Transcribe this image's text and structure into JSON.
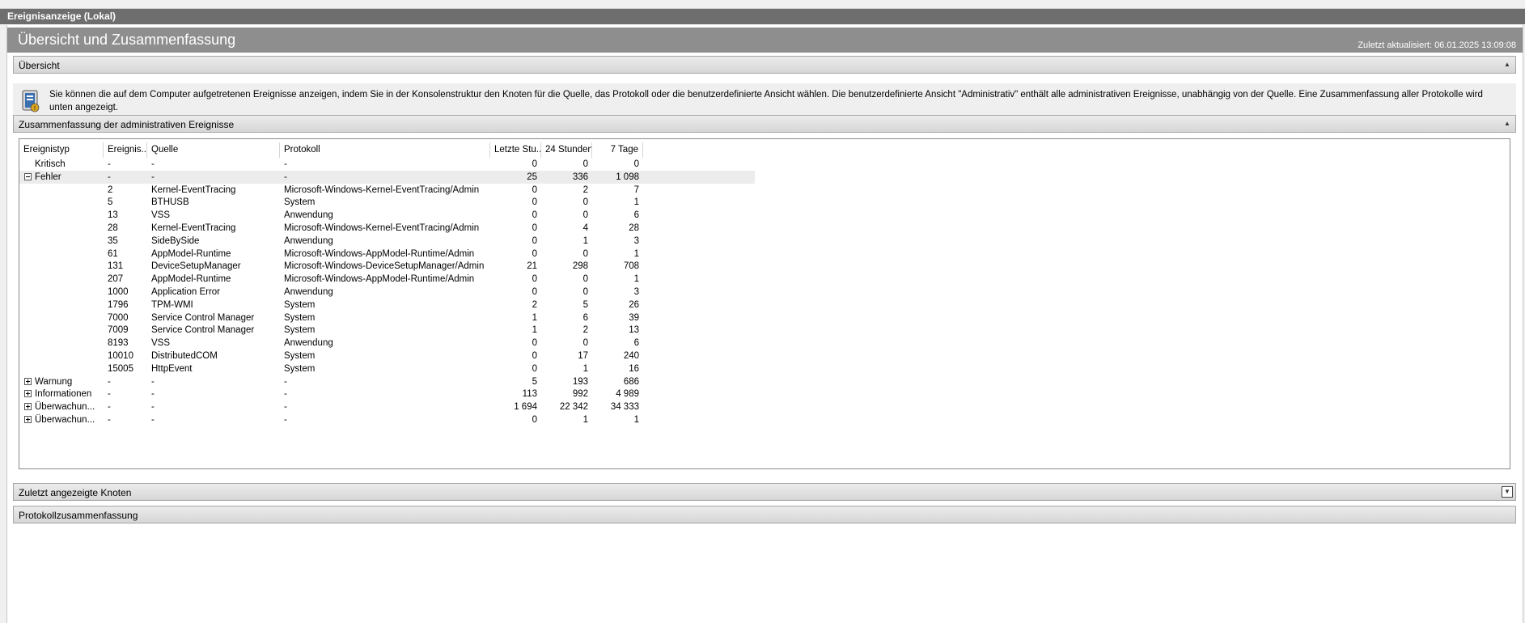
{
  "window": {
    "title": "Ereignisanzeige (Lokal)"
  },
  "header": {
    "title": "Übersicht und Zusammenfassung",
    "updated": "Zuletzt aktualisiert: 06.01.2025 13:09:08"
  },
  "sections": {
    "overview": {
      "label": "Übersicht",
      "toggle_icon": "collapse-icon"
    },
    "admin_summary": {
      "label": "Zusammenfassung der administrativen Ereignisse",
      "toggle_icon": "collapse-icon"
    },
    "recent_nodes": {
      "label": "Zuletzt angezeigte Knoten",
      "toggle_icon": "expand-icon"
    },
    "log_summary": {
      "label": "Protokollzusammenfassung"
    }
  },
  "overview_text": "Sie können die auf dem Computer aufgetretenen Ereignisse anzeigen, indem Sie in der Konsolenstruktur den Knoten für die Quelle, das Protokoll oder die benutzerdefinierte Ansicht wählen. Die benutzerdefinierte Ansicht \"Administrativ\" enthält alle administrativen Ereignisse, unabhängig von der Quelle. Eine Zusammenfassung aller Protokolle wird unten angezeigt.",
  "overview_icon": "event-viewer-icon",
  "table": {
    "columns": [
      "Ereignistyp",
      "Ereignis...",
      "Quelle",
      "Protokoll",
      "Letzte Stu...",
      "24 Stunden",
      "7 Tage"
    ],
    "rows": [
      {
        "type": "Kritisch",
        "id": "-",
        "source": "-",
        "log": "-",
        "hour": "0",
        "day": "0",
        "week": "0",
        "expander": "none"
      },
      {
        "type": "Fehler",
        "id": "-",
        "source": "-",
        "log": "-",
        "hour": "25",
        "day": "336",
        "week": "1 098",
        "expander": "minus",
        "selected": true
      },
      {
        "type": "",
        "id": "2",
        "source": "Kernel-EventTracing",
        "log": "Microsoft-Windows-Kernel-EventTracing/Admin",
        "hour": "0",
        "day": "2",
        "week": "7"
      },
      {
        "type": "",
        "id": "5",
        "source": "BTHUSB",
        "log": "System",
        "hour": "0",
        "day": "0",
        "week": "1"
      },
      {
        "type": "",
        "id": "13",
        "source": "VSS",
        "log": "Anwendung",
        "hour": "0",
        "day": "0",
        "week": "6"
      },
      {
        "type": "",
        "id": "28",
        "source": "Kernel-EventTracing",
        "log": "Microsoft-Windows-Kernel-EventTracing/Admin",
        "hour": "0",
        "day": "4",
        "week": "28"
      },
      {
        "type": "",
        "id": "35",
        "source": "SideBySide",
        "log": "Anwendung",
        "hour": "0",
        "day": "1",
        "week": "3"
      },
      {
        "type": "",
        "id": "61",
        "source": "AppModel-Runtime",
        "log": "Microsoft-Windows-AppModel-Runtime/Admin",
        "hour": "0",
        "day": "0",
        "week": "1"
      },
      {
        "type": "",
        "id": "131",
        "source": "DeviceSetupManager",
        "log": "Microsoft-Windows-DeviceSetupManager/Admin",
        "hour": "21",
        "day": "298",
        "week": "708"
      },
      {
        "type": "",
        "id": "207",
        "source": "AppModel-Runtime",
        "log": "Microsoft-Windows-AppModel-Runtime/Admin",
        "hour": "0",
        "day": "0",
        "week": "1"
      },
      {
        "type": "",
        "id": "1000",
        "source": "Application Error",
        "log": "Anwendung",
        "hour": "0",
        "day": "0",
        "week": "3"
      },
      {
        "type": "",
        "id": "1796",
        "source": "TPM-WMI",
        "log": "System",
        "hour": "2",
        "day": "5",
        "week": "26"
      },
      {
        "type": "",
        "id": "7000",
        "source": "Service Control Manager",
        "log": "System",
        "hour": "1",
        "day": "6",
        "week": "39"
      },
      {
        "type": "",
        "id": "7009",
        "source": "Service Control Manager",
        "log": "System",
        "hour": "1",
        "day": "2",
        "week": "13"
      },
      {
        "type": "",
        "id": "8193",
        "source": "VSS",
        "log": "Anwendung",
        "hour": "0",
        "day": "0",
        "week": "6"
      },
      {
        "type": "",
        "id": "10010",
        "source": "DistributedCOM",
        "log": "System",
        "hour": "0",
        "day": "17",
        "week": "240"
      },
      {
        "type": "",
        "id": "15005",
        "source": "HttpEvent",
        "log": "System",
        "hour": "0",
        "day": "1",
        "week": "16"
      },
      {
        "type": "Warnung",
        "id": "-",
        "source": "-",
        "log": "-",
        "hour": "5",
        "day": "193",
        "week": "686",
        "expander": "plus"
      },
      {
        "type": "Informationen",
        "id": "-",
        "source": "-",
        "log": "-",
        "hour": "113",
        "day": "992",
        "week": "4 989",
        "expander": "plus"
      },
      {
        "type": "Überwachun...",
        "id": "-",
        "source": "-",
        "log": "-",
        "hour": "1 694",
        "day": "22 342",
        "week": "34 333",
        "expander": "plus"
      },
      {
        "type": "Überwachun...",
        "id": "-",
        "source": "-",
        "log": "-",
        "hour": "0",
        "day": "1",
        "week": "1",
        "expander": "plus"
      }
    ]
  }
}
